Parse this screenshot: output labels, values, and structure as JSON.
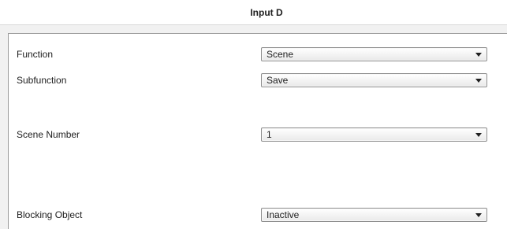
{
  "header": {
    "title": "Input D"
  },
  "form": {
    "fields": [
      {
        "label": "Function",
        "value": "Scene"
      },
      {
        "label": "Subfunction",
        "value": "Save"
      },
      {
        "label": "Scene Number",
        "value": "1"
      },
      {
        "label": "Blocking Object",
        "value": "Inactive"
      }
    ]
  },
  "icons": {
    "dropdown": "chevron-down-icon"
  }
}
